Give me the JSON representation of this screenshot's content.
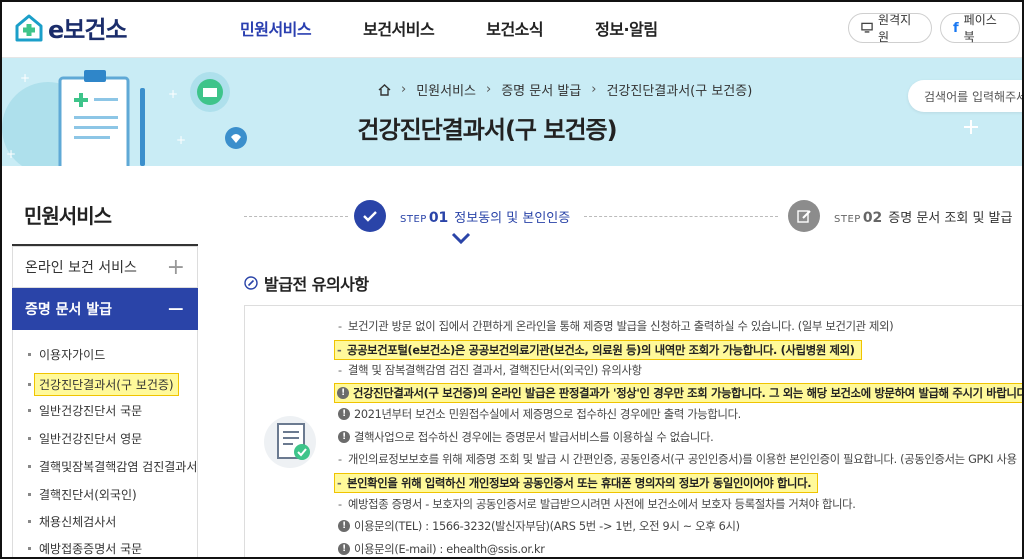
{
  "header": {
    "logo_text": "e보건소",
    "nav": [
      "민원서비스",
      "보건서비스",
      "보건소식",
      "정보·알림"
    ],
    "remote_label": "원격지원",
    "facebook_label": "페이스북"
  },
  "banner": {
    "breadcrumb": [
      "민원서비스",
      "증명 문서 발급",
      "건강진단결과서(구 보건증)"
    ],
    "title": "건강진단결과서(구 보건증)",
    "search_placeholder": "검색어를 입력해주세"
  },
  "sidebar": {
    "title": "민원서비스",
    "sections": [
      {
        "label": "온라인 보건 서비스",
        "toggle": "+"
      },
      {
        "label": "증명 문서 발급",
        "toggle": "−"
      }
    ],
    "links": [
      "이용자가이드",
      "건강진단결과서(구 보건증)",
      "일반건강진단서 국문",
      "일반건강진단서 영문",
      "결핵및잠복결핵감염 검진결과서",
      "결핵진단서(외국인)",
      "채용신체검사서",
      "예방접종증명서 국문"
    ]
  },
  "steps": [
    {
      "step": "STEP",
      "num": "01",
      "label": "정보동의 및 본인인증"
    },
    {
      "step": "STEP",
      "num": "02",
      "label": "증명 문서 조회 및 발급"
    }
  ],
  "section": {
    "title": "발급전 유의사항"
  },
  "notes": [
    "보건기관 방문 없이 집에서 간편하게 온라인을 통해 제증명 발급을 신청하고 출력하실 수 있습니다. (일부 보건기관 제외)",
    "공공보건포털(e보건소)은 공공보건의료기관(보건소, 의료원 등)의 내역만 조회가 가능합니다. (사립병원 제외)",
    "결핵 및 잠복결핵감염 검진 결과서, 결핵진단서(외국인) 유의사항",
    "건강진단결과서(구 보건증)의 온라인 발급은 판정결과가 '정상'인 경우만 조회 가능합니다. 그 외는 해당 보건소에 방문하여 발급해 주시기 바랍니다.",
    "2021년부터 보건소 민원접수실에서 제증명으로 접수하신 경우에만 출력 가능합니다.",
    "결핵사업으로 접수하신 경우에는 증명문서 발급서비스를 이용하실 수 없습니다.",
    "개인의료정보보호를 위해 제증명 조회 및 발급 시 간편인증, 공동인증서(구 공인인증서)를 이용한 본인인증이 필요합니다. (공동인증서는 GPKI 사용",
    "본인확인을 위해 입력하신 개인정보와 공동인증서 또는 휴대폰 명의자의 정보가 동일인이어야 합니다.",
    "예방접종 증명서 - 보호자의 공동인증서로 발급받으시려면 사전에 보건소에서 보호자 등록절차를 거쳐야 합니다.",
    "이용문의(TEL) : 1566-3232(발신자부담)(ARS 5번 -> 1번, 오전 9시 ~ 오후 6시)",
    "이용문의(E-mail) : ehealth@ssis.or.kr"
  ],
  "colors": {
    "primary": "#2a44a8",
    "banner_bg": "#c9ecf5",
    "highlight": "#fff99a",
    "highlight_border": "#f0c400"
  }
}
